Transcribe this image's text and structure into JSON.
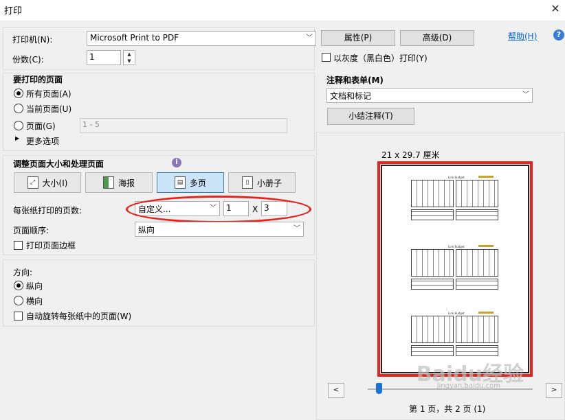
{
  "window": {
    "title": "打印"
  },
  "printer": {
    "label": "打印机(N):",
    "value": "Microsoft Print to PDF",
    "properties_btn": "属性(P)",
    "advanced_btn": "高级(D)",
    "help_link": "帮助(H)",
    "copies_label": "份数(C):",
    "copies_value": "1",
    "grayscale_label": "以灰度（黑白色）打印(Y)"
  },
  "pages_to_print": {
    "heading": "要打印的页面",
    "all_pages": "所有页面(A)",
    "current_page": "当前页面(U)",
    "pages": "页面(G)",
    "pages_placeholder": "1 - 5",
    "more_options": "更多选项"
  },
  "sizing": {
    "heading": "调整页面大小和处理页面",
    "size_btn": "大小(I)",
    "poster_btn": "海报",
    "multiple_btn": "多页",
    "booklet_btn": "小册子",
    "pages_per_sheet_label": "每张纸打印的页数:",
    "pages_per_sheet_value": "自定义...",
    "cols_value": "1",
    "times": "X",
    "rows_value": "3",
    "page_order_label": "页面顺序:",
    "page_order_value": "纵向",
    "print_border_label": "打印页面边框"
  },
  "orientation": {
    "heading": "方向:",
    "portrait": "纵向",
    "landscape": "横向",
    "auto_rotate": "自动旋转每张纸中的页面(W)"
  },
  "comments": {
    "heading": "注释和表单(M)",
    "value": "文档和标记",
    "summarize_btn": "小结注释(T)"
  },
  "preview": {
    "size_label": "21 x 29.7 厘米",
    "mini_title": "Link Budget",
    "page_status": "第 1 页，共 2 页 (1)",
    "prev": "<",
    "next": ">",
    "highlight_color": "#e8231c"
  },
  "watermark": {
    "text": "Baidu经验",
    "sub": "jingyan.baidu.com"
  }
}
